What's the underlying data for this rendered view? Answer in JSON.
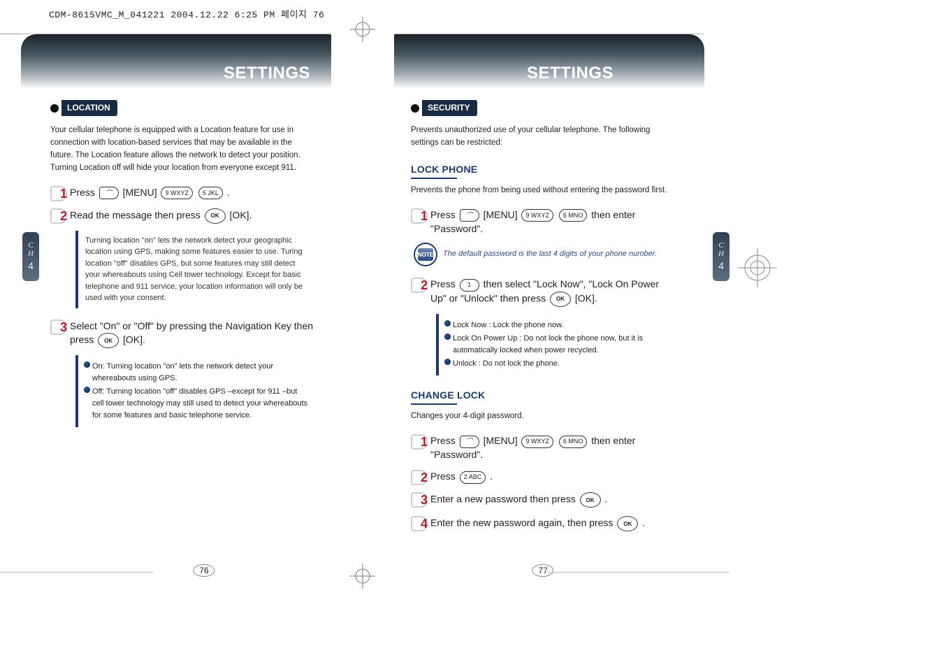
{
  "header": "CDM-8615VMC_M_041221  2004.12.22 6:25 PM  페이지 76",
  "left": {
    "title": "SETTINGS",
    "tag": "LOCATION",
    "intro": "Your cellular telephone is equipped with a Location feature for use in connection with location-based services that may be available in the future. The Location feature allows the network to detect your position. Turning Location off will hide your location from everyone except 911.",
    "s1": "Press       [MENU]            .",
    "s2": "Read the message then press        [OK].",
    "info": "Turning location \"on\" lets the network detect your geographic location using GPS, making some features easier to use. Turing location \"off\" disables GPS, but some features may still detect your whereabouts using Cell tower technology. Except for basic telephone and 911 service, your location information will only be used with your consent.",
    "s3": "Select \"On\" or \"Off\" by pressing the Navigation Key then press       [OK].",
    "b1": "On: Turning location \"on\" lets the network detect your whereabouts using GPS.",
    "b2": "Off: Turning location \"off\" disables GPS –except for 911 –but cell tower technology may still used to detect your whereabouts for some features and basic telephone service.",
    "page": "76"
  },
  "right": {
    "title": "SETTINGS",
    "tag": "SECURITY",
    "intro": "Prevents unauthorized use of your cellular telephone. The following settings can be restricted:",
    "lock_h": "LOCK PHONE",
    "lock_p": "Prevents the phone from being used without entering the password first.",
    "l1": "Press       [MENU]             then enter \"Password\".",
    "note": "The default password is the last 4 digits of your phone number.",
    "l2": "Press        then select \"Lock Now\", \"Lock On Power Up\" or \"Unlock\" then press        [OK].",
    "lb1": "Lock Now : Lock the phone now.",
    "lb2": "Lock On Power Up : Do not lock the phone now, but it is automatically locked when power recycled.",
    "lb3": "Unlock : Do not lock the phone.",
    "chg_h": "CHANGE LOCK",
    "chg_p": "Changes your 4-digit password.",
    "c1": "Press       [MENU]             then enter \"Password\".",
    "c2": "Press         .",
    "c3": "Enter a new password then press        .",
    "c4": "Enter the new password again, then press        .",
    "page": "77"
  },
  "ch": {
    "c": "C",
    "h": "H",
    "n": "4"
  },
  "keys": {
    "soft": "",
    "ok": "OK",
    "k9": "9 WXYZ",
    "k5": "5 JKL",
    "k6": "6 MNO",
    "k1": "1",
    "k2": "2 ABC"
  },
  "note_label": "NOTE"
}
